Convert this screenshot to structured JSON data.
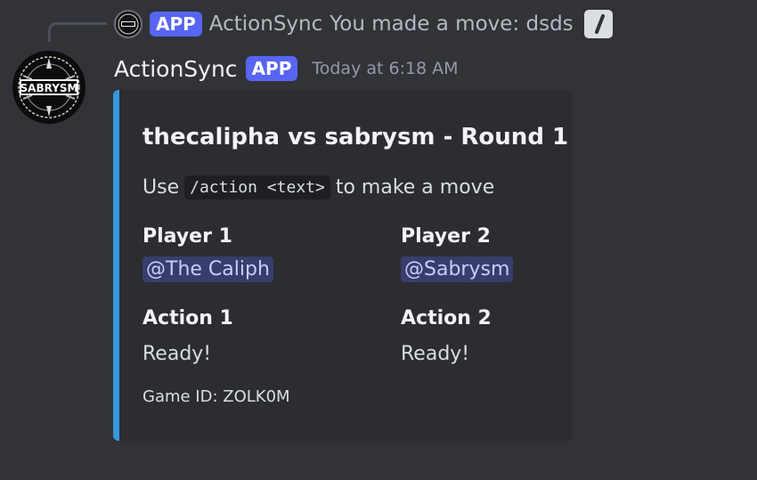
{
  "reply": {
    "app_badge": "APP",
    "author": "ActionSync",
    "text": "You made a move: dsds",
    "command_icon": "slash-command-icon"
  },
  "message": {
    "author": "ActionSync",
    "app_badge": "APP",
    "timestamp": "Today at 6:18 AM",
    "avatar_text": "SABRYSM"
  },
  "embed": {
    "accent_color": "#3498db",
    "title": "thecalipha vs sabrysm - Round 1",
    "description": {
      "prefix": "Use",
      "code": "/action <text>",
      "suffix": "to make a move"
    },
    "fields": {
      "player1": {
        "name": "Player 1",
        "value": "@The Caliph"
      },
      "player2": {
        "name": "Player 2",
        "value": "@Sabrysm"
      },
      "action1": {
        "name": "Action 1",
        "value": "Ready!"
      },
      "action2": {
        "name": "Action 2",
        "value": "Ready!"
      }
    },
    "footer": "Game ID: ZOLK0M"
  },
  "colors": {
    "background": "#313338",
    "embed_background": "#2b2d31",
    "app_badge": "#5865f2",
    "mention_text": "#c9cdfb"
  }
}
